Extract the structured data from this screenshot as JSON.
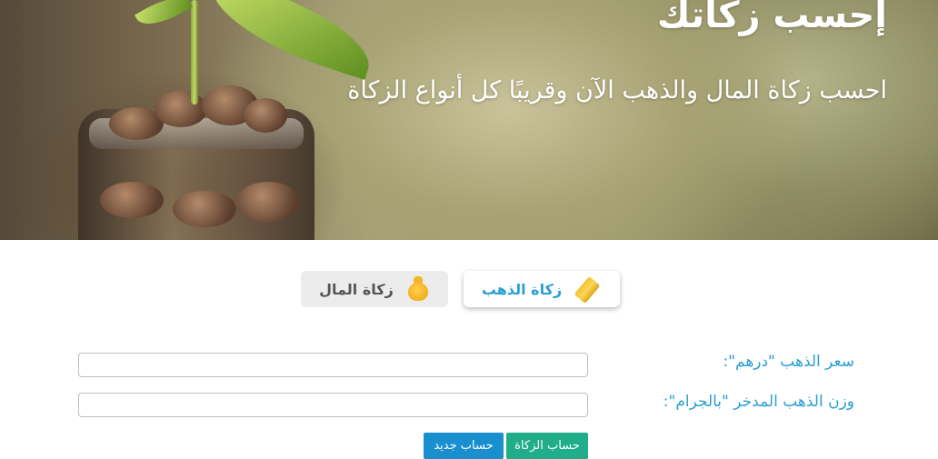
{
  "hero": {
    "title": "إحسب زكاتك",
    "subtitle": "احسب زكاة المال والذهب الآن وقريبًا كل أنواع الزكاة"
  },
  "tabs": [
    {
      "label": "زكاة الذهب",
      "icon": "gold-bar-icon",
      "active": true
    },
    {
      "label": "زكاة المال",
      "icon": "money-bag-icon",
      "active": false
    }
  ],
  "form": {
    "gold_price_label": "سعر الذهب \"درهم\":",
    "gold_price_value": "",
    "gold_weight_label": "وزن الذهب المدخر \"بالجرام\":",
    "gold_weight_value": ""
  },
  "buttons": {
    "calculate": "حساب الزكاة",
    "new": "حساب جديد"
  },
  "colors": {
    "accent": "#2c9fd3",
    "calculate_button": "#1fad8a",
    "new_button": "#1a8fd0"
  }
}
